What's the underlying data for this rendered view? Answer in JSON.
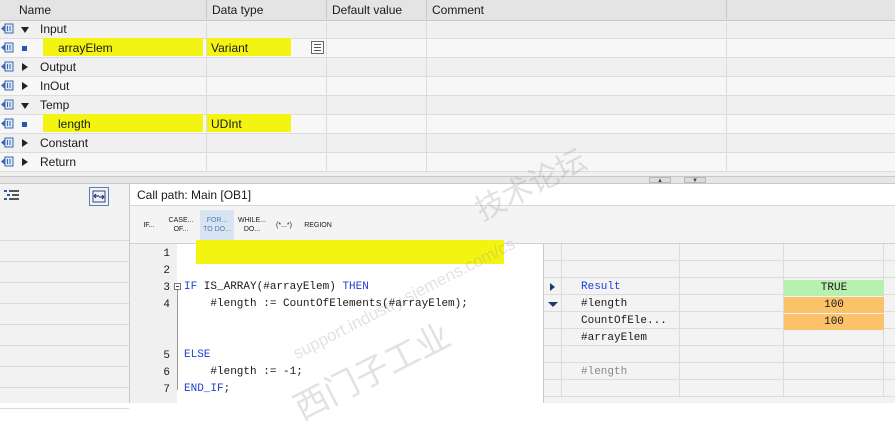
{
  "interface": {
    "columns": [
      "Name",
      "Data type",
      "Default value",
      "Comment"
    ],
    "rows": [
      {
        "name": "Input",
        "type": "",
        "expander": "expanded",
        "kind": "section"
      },
      {
        "name": "arrayElem",
        "type": "Variant",
        "kind": "item",
        "highlighted": true,
        "has_ellipsis": true
      },
      {
        "name": "Output",
        "type": "",
        "expander": "collapsed",
        "kind": "section"
      },
      {
        "name": "InOut",
        "type": "",
        "expander": "collapsed",
        "kind": "section"
      },
      {
        "name": "Temp",
        "type": "",
        "expander": "expanded",
        "kind": "section"
      },
      {
        "name": "length",
        "type": "UDInt",
        "kind": "item",
        "highlighted": true
      },
      {
        "name": "Constant",
        "type": "",
        "expander": "collapsed",
        "kind": "section"
      },
      {
        "name": "Return",
        "type": "",
        "expander": "collapsed",
        "kind": "section"
      }
    ]
  },
  "editor": {
    "call_path": "Call path: Main [OB1]",
    "ribbon": [
      {
        "line1": "IF...",
        "line2": ""
      },
      {
        "line1": "CASE...",
        "line2": "OF..."
      },
      {
        "line1": "FOR...",
        "line2": "TO DO..."
      },
      {
        "line1": "WHILE...",
        "line2": "DO..."
      },
      {
        "line1": "(*...*)",
        "line2": ""
      },
      {
        "line1": "REGION",
        "line2": ""
      }
    ],
    "lines": [
      {
        "num": "1",
        "text": ""
      },
      {
        "num": "2",
        "text": ""
      },
      {
        "num": "3",
        "kw1": "IF",
        "mid": " IS_ARRAY(#arrayElem) ",
        "kw2": "THEN"
      },
      {
        "num": "4",
        "text": "    #length := CountOfElements(#arrayElem);"
      },
      {
        "num": "5",
        "kw1": "ELSE"
      },
      {
        "num": "6",
        "text": "    #length := -1;"
      },
      {
        "num": "7",
        "kw1": "END_IF",
        "mid": ";"
      }
    ]
  },
  "monitor": {
    "rows": [
      {
        "label": "Result",
        "value": "TRUE",
        "style": "green",
        "marker": "right"
      },
      {
        "label": "#length",
        "value": "100",
        "style": "orange",
        "marker": "down"
      },
      {
        "label": "CountOfEle...",
        "value": "100",
        "style": "orange"
      },
      {
        "label": "#arrayElem",
        "value": ""
      },
      {
        "label": "#length",
        "value": "",
        "style": "grey"
      }
    ]
  },
  "watermark": {
    "line1": "西门子工业",
    "line2": "support.industry.siemens.com/cs",
    "line3": "技术论坛"
  },
  "colors": {
    "highlight": "#f4f412",
    "keyword": "#1f3fd2",
    "monitor_true": "#b8f0b0",
    "monitor_value": "#fbc26a"
  }
}
